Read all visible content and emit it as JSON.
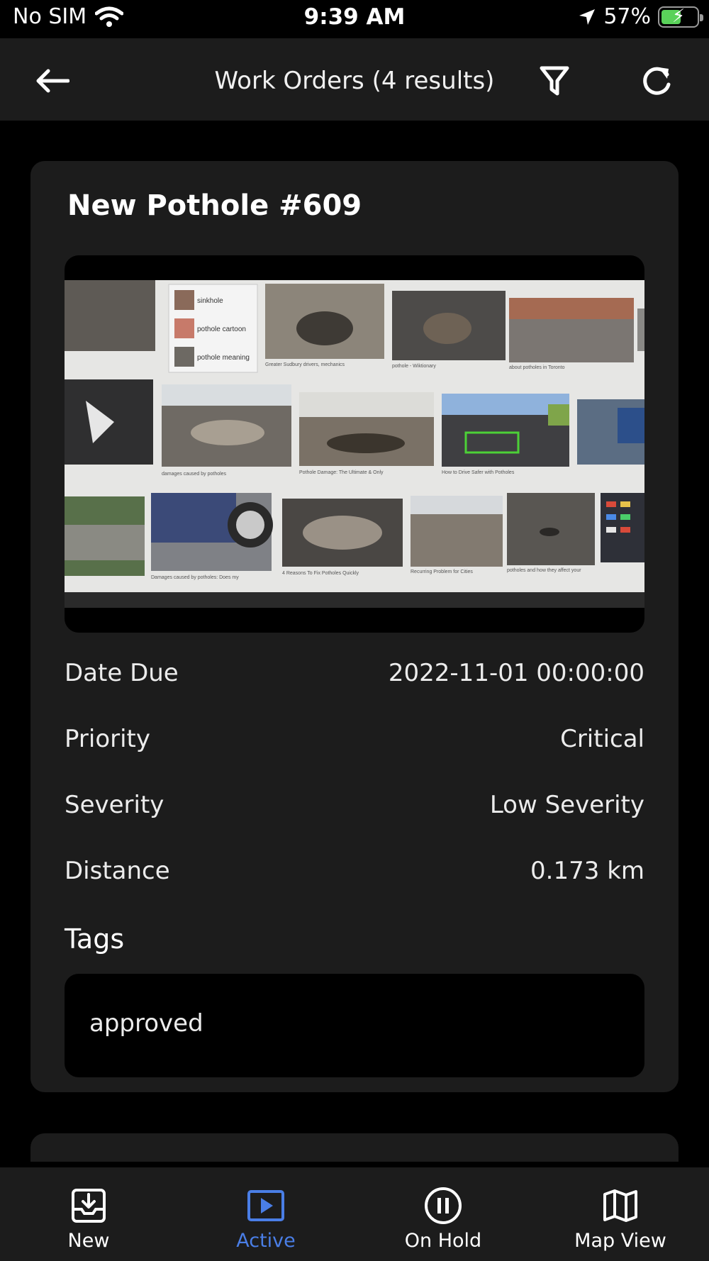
{
  "status_bar": {
    "carrier": "No SIM",
    "time": "9:39 AM",
    "battery_percent": "57%",
    "battery_level": 0.57,
    "icons": [
      "wifi-icon",
      "location-arrow-icon",
      "battery-charging-icon"
    ]
  },
  "header": {
    "title": "Work Orders (4 results)",
    "icons": [
      "back-arrow-icon",
      "filter-icon",
      "refresh-icon"
    ]
  },
  "work_order": {
    "title": "New Pothole #609",
    "photo": {
      "image_labels": [
        "sinkhole",
        "pothole cartoon",
        "pothole meaning",
        "Greater Sudbury drivers, mechanics",
        "pothole - Wiktionary",
        "about potholes in Toronto",
        "damages caused by potholes",
        "Pothole Damage: The Ultimate & Only",
        "How to Drive Safer with Potholes",
        "Damages caused by potholes: Does my",
        "4 Reasons To Fix Potholes Quickly",
        "Recurring Problem for Cities",
        "potholes and how they affect your"
      ]
    },
    "fields": [
      {
        "label": "Date Due",
        "value": "2022-11-01 00:00:00"
      },
      {
        "label": "Priority",
        "value": "Critical"
      },
      {
        "label": "Severity",
        "value": "Low Severity"
      },
      {
        "label": "Distance",
        "value": "0.173 km"
      }
    ],
    "tags_label": "Tags",
    "tags": [
      "approved"
    ]
  },
  "tabs": [
    {
      "label": "New",
      "icon": "inbox-download-icon",
      "active": false
    },
    {
      "label": "Active",
      "icon": "play-square-icon",
      "active": true
    },
    {
      "label": "On Hold",
      "icon": "pause-circle-icon",
      "active": false
    },
    {
      "label": "Map View",
      "icon": "map-icon",
      "active": false
    }
  ],
  "colors": {
    "background": "#000000",
    "surface": "#1c1c1c",
    "accent": "#4a7ee6",
    "battery_green": "#5ad25a",
    "highlight_box": "#4cd137"
  }
}
